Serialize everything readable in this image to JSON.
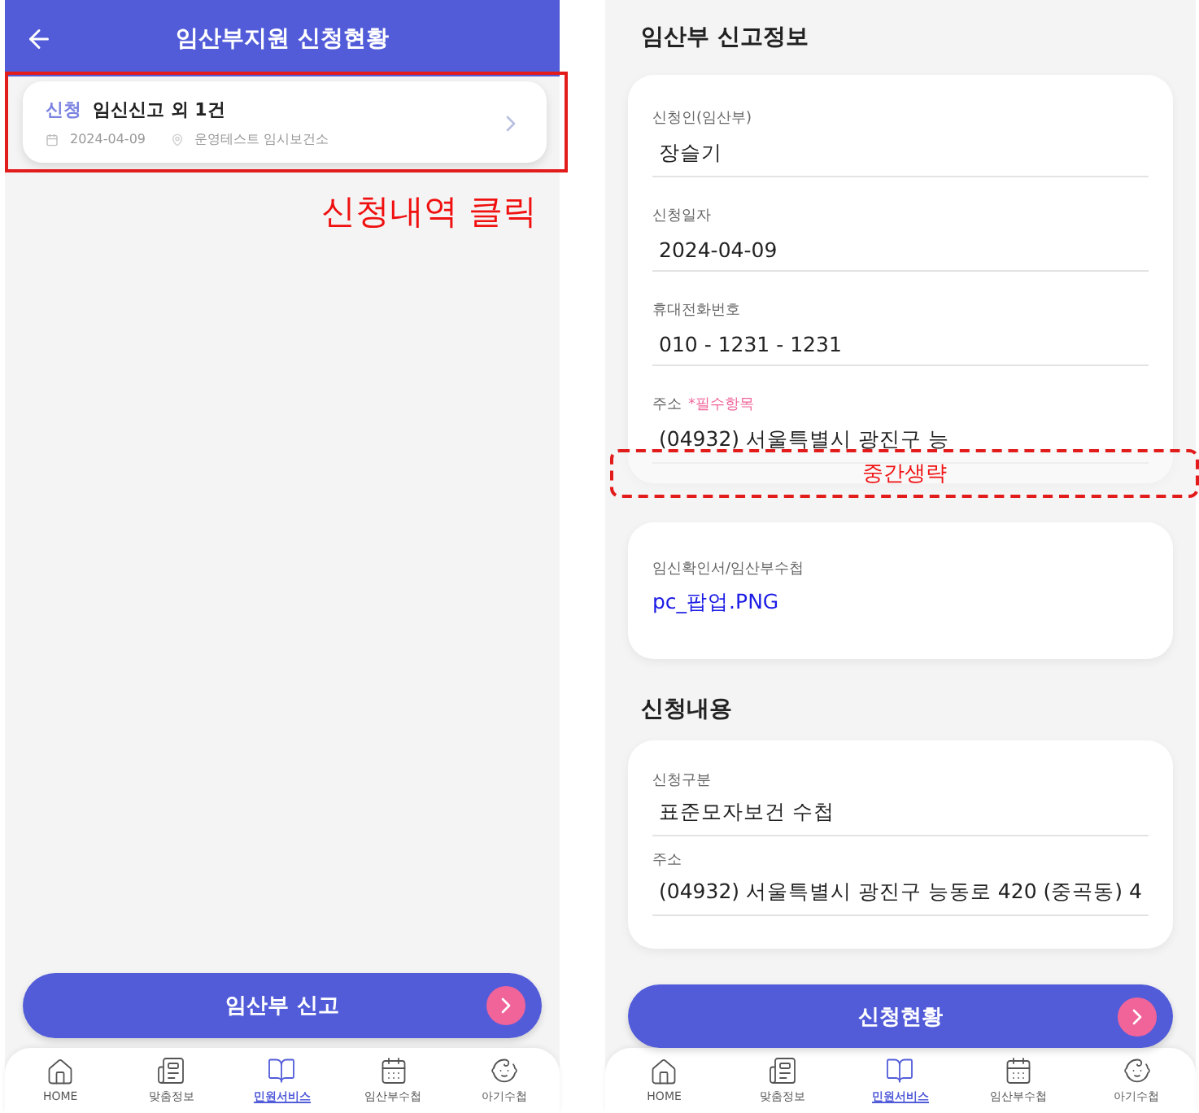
{
  "status_screen": {
    "title": "임산부지원 신청현황",
    "applications": [
      {
        "tag": "신청",
        "title": "임신신고 외 1건",
        "date": "2024-04-09",
        "place": "운영테스트 임시보건소"
      }
    ],
    "button": "임산부 신고",
    "nav": [
      {
        "label": "HOME",
        "selected": false
      },
      {
        "label": "맞춤정보",
        "selected": false
      },
      {
        "label": "민원서비스",
        "selected": true
      },
      {
        "label": "임산부수첩",
        "selected": false
      },
      {
        "label": "아기수첩",
        "selected": false
      }
    ]
  },
  "detail_screen": {
    "info_heading": "임산부 신고정보",
    "info_fields": [
      {
        "label": "신청인(임산부)",
        "value": "장슬기"
      },
      {
        "label": "신청일자",
        "value": "2024-04-09"
      },
      {
        "label": "휴대전화번호",
        "value": "010 - 1231 - 1231"
      },
      {
        "label": "주소",
        "note": "*필수항목",
        "value": "(04932) 서울특별시 광진구 능"
      }
    ],
    "attachment": {
      "label": "임신확인서/임산부수첩",
      "file": "pc_팝업.PNG"
    },
    "content_heading": "신청내용",
    "content_fields": [
      {
        "label": "신청구분",
        "value": "표준모자보건 수첩"
      },
      {
        "label": "주소",
        "value": "(04932) 서울특별시 광진구 능동로 420 (중곡동) 4"
      }
    ],
    "button": "신청현황",
    "nav": [
      {
        "label": "HOME",
        "selected": false
      },
      {
        "label": "맞춤정보",
        "selected": false
      },
      {
        "label": "민원서비스",
        "selected": true
      },
      {
        "label": "임산부수첩",
        "selected": false
      },
      {
        "label": "아기수첩",
        "selected": false
      }
    ]
  },
  "annotations": {
    "click_note": "신청내역 클릭",
    "omission_note": "중간생략"
  }
}
